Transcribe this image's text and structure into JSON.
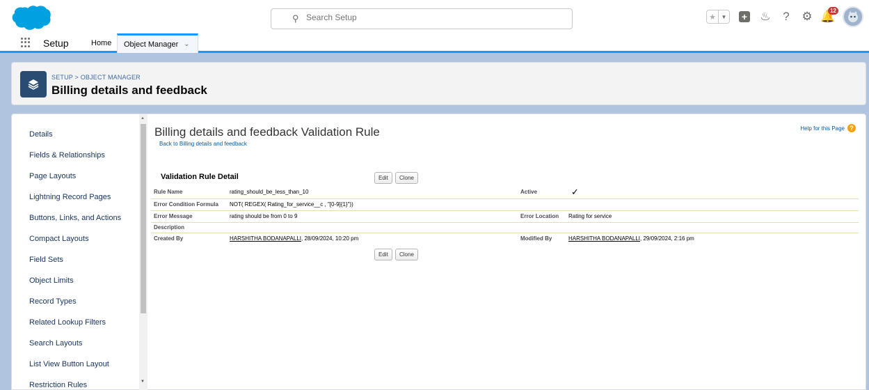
{
  "header": {
    "search_placeholder": "Search Setup",
    "notification_count": "12"
  },
  "nav": {
    "app_name": "Setup",
    "tabs": [
      {
        "label": "Home"
      },
      {
        "label": "Object Manager",
        "active": true
      }
    ]
  },
  "page_header": {
    "breadcrumb": "SETUP > OBJECT MANAGER",
    "title": "Billing details and feedback"
  },
  "sidebar": {
    "items": [
      {
        "label": "Details"
      },
      {
        "label": "Fields & Relationships"
      },
      {
        "label": "Page Layouts"
      },
      {
        "label": "Lightning Record Pages"
      },
      {
        "label": "Buttons, Links, and Actions"
      },
      {
        "label": "Compact Layouts"
      },
      {
        "label": "Field Sets"
      },
      {
        "label": "Object Limits"
      },
      {
        "label": "Record Types"
      },
      {
        "label": "Related Lookup Filters"
      },
      {
        "label": "Search Layouts"
      },
      {
        "label": "List View Button Layout"
      },
      {
        "label": "Restriction Rules"
      }
    ]
  },
  "main": {
    "title": "Billing details and feedback Validation Rule",
    "back_link": "Back to Billing details and feedback",
    "help_link": "Help for this Page",
    "section_title": "Validation Rule Detail",
    "edit_label": "Edit",
    "clone_label": "Clone",
    "fields": {
      "rule_name": {
        "label": "Rule Name",
        "value": "rating_should_be_less_than_10"
      },
      "active": {
        "label": "Active",
        "value": "✓"
      },
      "formula": {
        "label": "Error Condition Formula",
        "value": "NOT( REGEX( Rating_for_service__c , \"[0-9]{1}\"))"
      },
      "error_message": {
        "label": "Error Message",
        "value": "rating should be from 0 to 9"
      },
      "error_location": {
        "label": "Error Location",
        "value": "Rating for service"
      },
      "description": {
        "label": "Description",
        "value": ""
      },
      "created_by": {
        "label": "Created By",
        "user": "HARSHITHA BODANAPALLI",
        "date": ", 28/09/2024, 10:20 pm"
      },
      "modified_by": {
        "label": "Modified By",
        "user": "HARSHITHA BODANAPALLI",
        "date": ", 29/09/2024, 2:16 pm"
      }
    }
  },
  "colors": {
    "brand_blue": "#1b96ff",
    "background": "#b0c4df",
    "header_icon": "#2a4c73",
    "link": "#015ba7",
    "badge": "#c23934"
  }
}
